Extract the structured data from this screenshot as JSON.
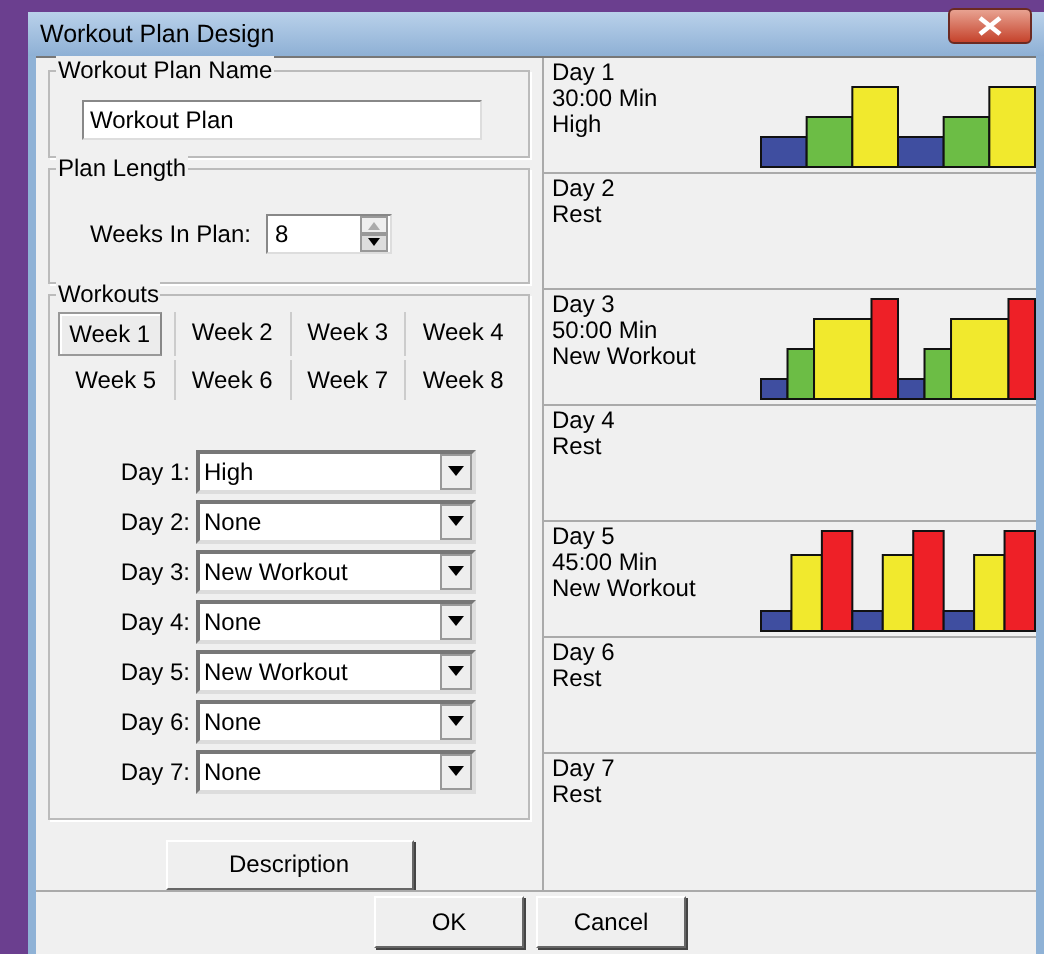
{
  "window": {
    "title": "Workout Plan Design"
  },
  "plan_name": {
    "label": "Workout Plan Name",
    "value": "Workout Plan"
  },
  "plan_length": {
    "label": "Plan Length",
    "field_label": "Weeks In Plan:",
    "value": "8"
  },
  "workouts": {
    "label": "Workouts",
    "tabs": [
      {
        "label": "Week 1",
        "selected": true
      },
      {
        "label": "Week 2",
        "selected": false
      },
      {
        "label": "Week 3",
        "selected": false
      },
      {
        "label": "Week 4",
        "selected": false
      },
      {
        "label": "Week 5",
        "selected": false
      },
      {
        "label": "Week 6",
        "selected": false
      },
      {
        "label": "Week 7",
        "selected": false
      },
      {
        "label": "Week 8",
        "selected": false
      }
    ],
    "days": [
      {
        "label": "Day 1:",
        "value": "High"
      },
      {
        "label": "Day 2:",
        "value": "None"
      },
      {
        "label": "Day 3:",
        "value": "New Workout"
      },
      {
        "label": "Day 4:",
        "value": "None"
      },
      {
        "label": "Day 5:",
        "value": "New Workout"
      },
      {
        "label": "Day 6:",
        "value": "None"
      },
      {
        "label": "Day 7:",
        "value": "None"
      }
    ]
  },
  "description_button": "Description",
  "schedule": [
    {
      "kind": "steps",
      "lines": [
        "Day 1",
        "30:00 Min",
        "High"
      ]
    },
    {
      "kind": "rest",
      "lines": [
        "Day 2",
        "Rest"
      ]
    },
    {
      "kind": "pyramid",
      "lines": [
        "Day 3",
        "50:00 Min",
        "New Workout"
      ]
    },
    {
      "kind": "rest",
      "lines": [
        "Day 4",
        "Rest"
      ]
    },
    {
      "kind": "intervals",
      "lines": [
        "Day 5",
        "45:00 Min",
        "New Workout"
      ]
    },
    {
      "kind": "rest",
      "lines": [
        "Day 6",
        "Rest"
      ]
    },
    {
      "kind": "rest",
      "lines": [
        "Day 7",
        "Rest"
      ]
    }
  ],
  "buttons": [
    "OK",
    "Cancel"
  ]
}
